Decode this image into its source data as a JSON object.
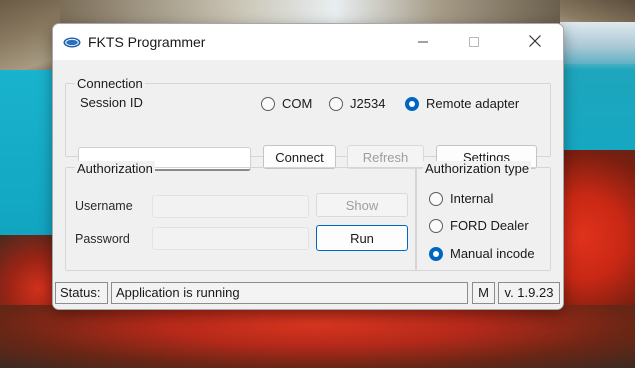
{
  "window": {
    "title": "FKTS Programmer"
  },
  "connection": {
    "group_title": "Connection",
    "session_label": "Session ID",
    "session_value": "",
    "radios": [
      {
        "label": "COM",
        "checked": false
      },
      {
        "label": "J2534",
        "checked": false
      },
      {
        "label": "Remote adapter",
        "checked": true
      }
    ],
    "buttons": {
      "connect": "Connect",
      "refresh": "Refresh",
      "settings": "Settings"
    }
  },
  "authorization": {
    "group_title": "Authorization",
    "username_label": "Username",
    "password_label": "Password",
    "username_value": "",
    "password_value": "",
    "show_button": "Show",
    "run_button": "Run"
  },
  "authorization_type": {
    "group_title": "Authorization type",
    "options": [
      {
        "label": "Internal",
        "checked": false
      },
      {
        "label": "FORD Dealer",
        "checked": false
      },
      {
        "label": "Manual incode",
        "checked": true
      }
    ]
  },
  "status_bar": {
    "label": "Status:",
    "message": "Application is running",
    "mode": "M",
    "version": "v. 1.9.23"
  },
  "colors": {
    "accent": "#0067c0",
    "window_bg": "#f0f0f0"
  },
  "icons": {
    "app": "fkts-logo-icon",
    "minimize": "minimize-icon",
    "maximize": "maximize-icon",
    "close": "close-icon"
  }
}
